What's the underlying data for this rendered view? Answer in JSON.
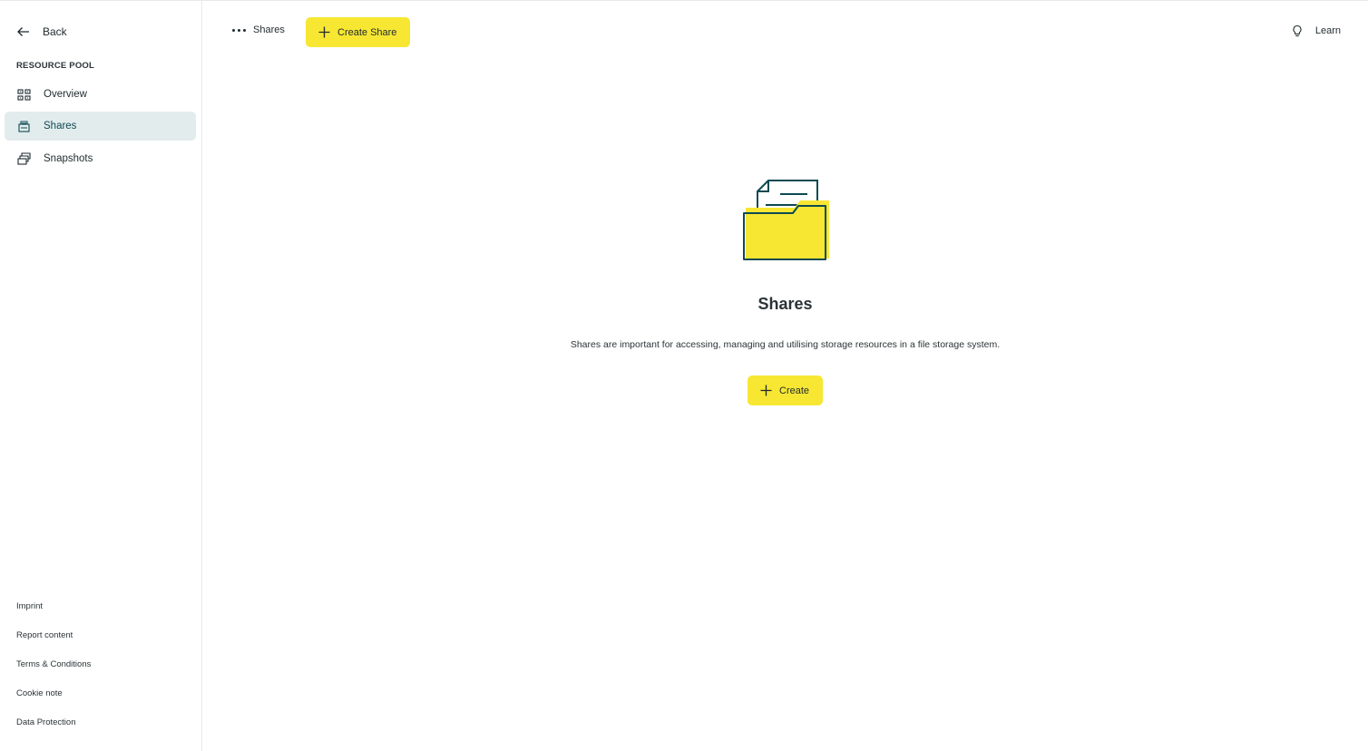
{
  "sidebar": {
    "back_label": "Back",
    "section_title": "RESOURCE POOL",
    "items": [
      {
        "label": "Overview",
        "icon": "grid-icon",
        "active": false
      },
      {
        "label": "Shares",
        "icon": "share-icon",
        "active": true
      },
      {
        "label": "Snapshots",
        "icon": "snapshot-icon",
        "active": false
      }
    ],
    "footer_links": [
      "Imprint",
      "Report content",
      "Terms & Conditions",
      "Cookie note",
      "Data Protection"
    ]
  },
  "header": {
    "breadcrumb_label": "Shares",
    "create_share_label": "Create Share",
    "learn_label": "Learn"
  },
  "empty_state": {
    "title": "Shares",
    "description": "Shares are important for accessing, managing and utilising storage resources in a file storage system.",
    "create_label": "Create",
    "illustration": "folder-document-icon"
  },
  "colors": {
    "accent": "#f7e733",
    "active_bg": "#e3eced",
    "primary_dark": "#0e4a51"
  }
}
